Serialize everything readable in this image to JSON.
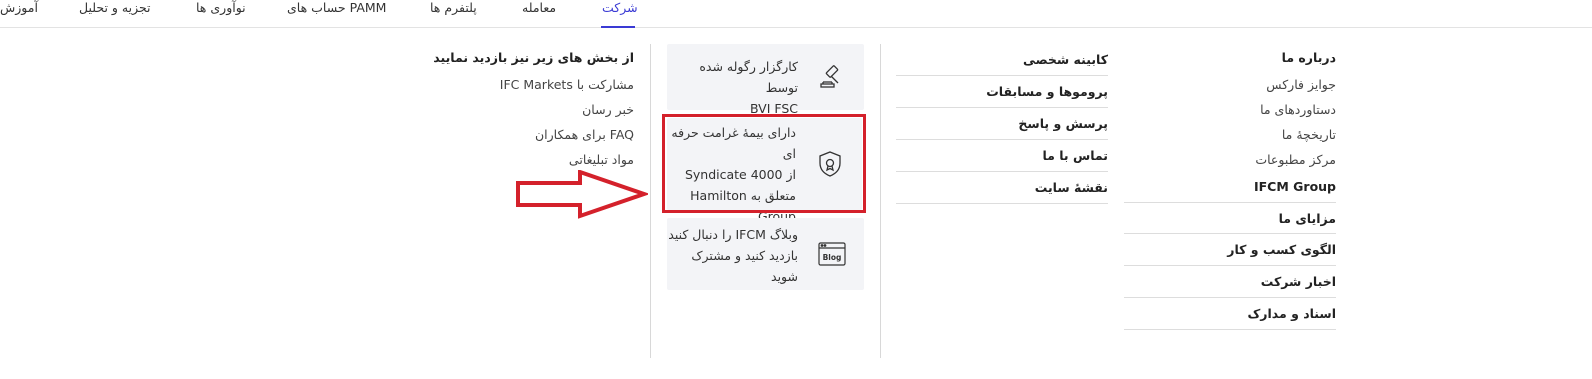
{
  "nav": {
    "items": [
      {
        "label": "آموزش",
        "active": false
      },
      {
        "label": "تجزیه و تحلیل",
        "active": false
      },
      {
        "label": "نوآوری ها",
        "active": false
      },
      {
        "label": "حساب های PAMM",
        "active": false
      },
      {
        "label": "پلتفرم ها",
        "active": false
      },
      {
        "label": "معامله",
        "active": false
      },
      {
        "label": "شرکت",
        "active": true
      }
    ],
    "accent_color": "#3a3ad4"
  },
  "about": {
    "heading": "درباره ما",
    "subitems": [
      "جوایز فارکس",
      "دستاوردهای ما",
      "تاریخچهٔ ما",
      "مرکز مطبوعات"
    ],
    "bold_items": [
      "IFCM Group",
      "مزایای ما",
      "الگوی کسب و کار",
      "اخبار شرکت",
      "اسناد و مدارک"
    ]
  },
  "cabinet": {
    "items": [
      "کابینه شخصی",
      "پروموها و مسابقات",
      "پرسش و پاسخ",
      "تماس با ما",
      "نقشهٔ سایت"
    ]
  },
  "cards": [
    {
      "icon": "gavel-icon",
      "lines": [
        "کارگزار رگوله شده توسط",
        "BVI FSC"
      ]
    },
    {
      "icon": "shield-badge-icon",
      "lines": [
        "دارای بیمهٔ غرامت حرفه ای",
        "از Syndicate 4000",
        "متعلق به Hamilton",
        "Group."
      ]
    },
    {
      "icon": "blog-icon",
      "icon_label": "Blog",
      "lines": [
        "وبلاگ IFCM را دنبال کنید",
        "بازدید کنید و مشترک",
        "شوید"
      ]
    }
  ],
  "more": {
    "heading": "از بخش های زیر نیز بازدید نمایید",
    "items": [
      "مشارکت با IFC Markets",
      "خبر رسان",
      "FAQ برای همکاران",
      "مواد تبلیغاتی"
    ]
  },
  "annotation": {
    "highlight_color": "#d4212b"
  }
}
